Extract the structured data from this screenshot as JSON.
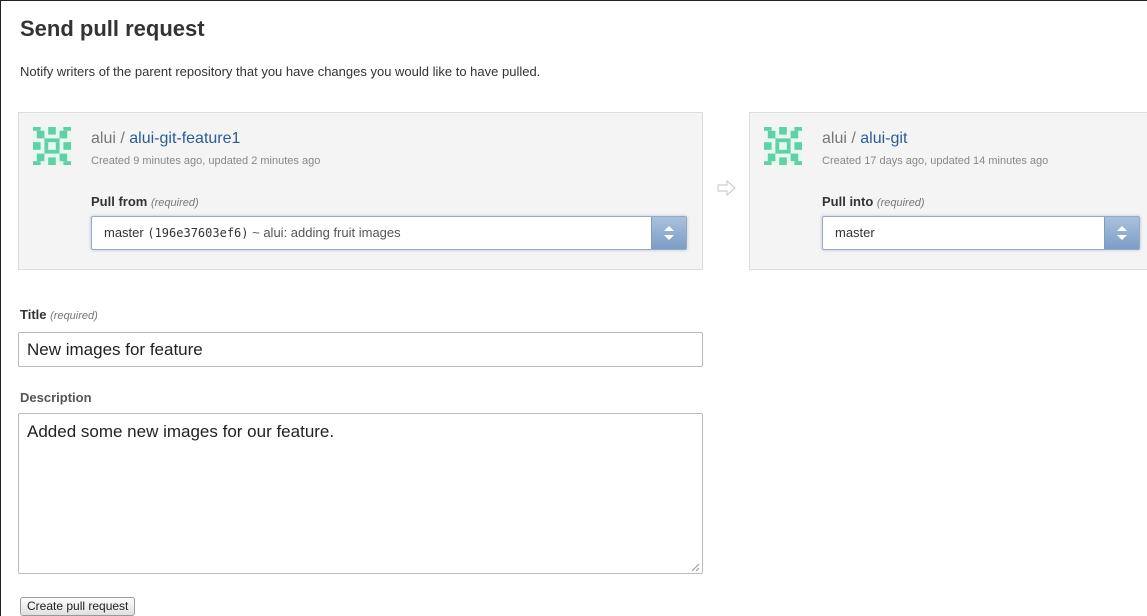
{
  "page": {
    "title": "Send pull request",
    "intro": "Notify writers of the parent repository that you have changes you would like to have pulled."
  },
  "from_repo": {
    "owner": "alui",
    "separator": " / ",
    "name": "alui-git-feature1",
    "meta": "Created 9 minutes ago, updated 2 minutes ago",
    "label": "Pull from",
    "required": "(required)",
    "branch": "master",
    "sha": "(196e37603ef6)",
    "commit": " ~ alui: adding fruit images"
  },
  "into_repo": {
    "owner": "alui",
    "separator": " / ",
    "name": "alui-git",
    "meta": "Created 17 days ago, updated 14 minutes ago",
    "label": "Pull into",
    "required": "(required)",
    "branch": "master"
  },
  "form": {
    "title_label": "Title",
    "title_required": "(required)",
    "title_value": "New images for feature",
    "description_label": "Description",
    "description_value": "Added some new images for our feature.",
    "submit_label": "Create pull request"
  },
  "colors": {
    "repo_link": "#2a5d96",
    "avatar_green": "#5fd1a6",
    "box_background": "#f4f4f4"
  },
  "icons": {
    "avatar": "identicon-avatar",
    "arrow": "right-arrow-icon",
    "select": "select-updown-icon"
  }
}
